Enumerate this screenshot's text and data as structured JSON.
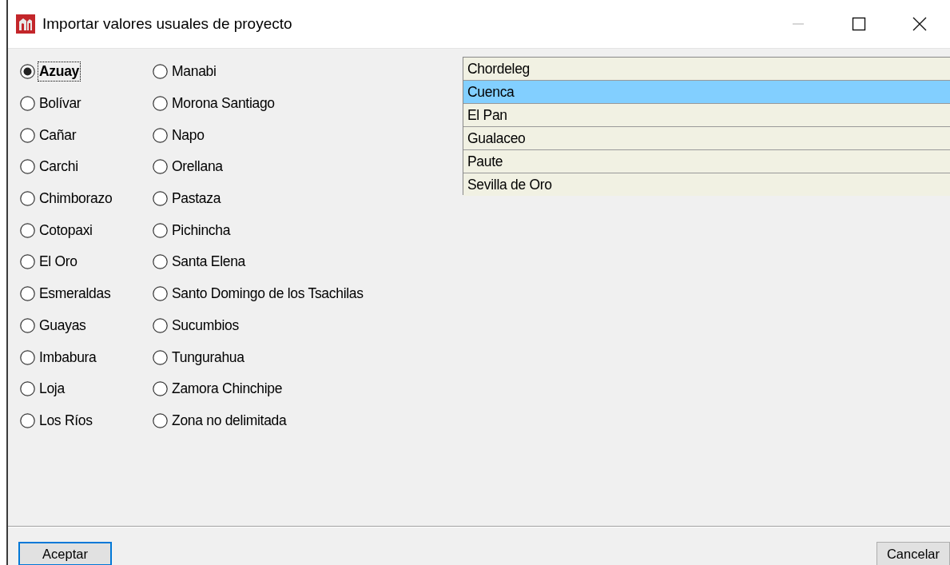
{
  "window": {
    "title": "Importar valores usuales de proyecto"
  },
  "provinces": [
    {
      "label": "Azuay",
      "selected": true
    },
    {
      "label": "Bolívar",
      "selected": false
    },
    {
      "label": "Cañar",
      "selected": false
    },
    {
      "label": "Carchi",
      "selected": false
    },
    {
      "label": "Chimborazo",
      "selected": false
    },
    {
      "label": "Cotopaxi",
      "selected": false
    },
    {
      "label": "El Oro",
      "selected": false
    },
    {
      "label": "Esmeraldas",
      "selected": false
    },
    {
      "label": "Guayas",
      "selected": false
    },
    {
      "label": "Imbabura",
      "selected": false
    },
    {
      "label": "Loja",
      "selected": false
    },
    {
      "label": "Los Ríos",
      "selected": false
    },
    {
      "label": "Manabi",
      "selected": false
    },
    {
      "label": "Morona Santiago",
      "selected": false
    },
    {
      "label": "Napo",
      "selected": false
    },
    {
      "label": "Orellana",
      "selected": false
    },
    {
      "label": "Pastaza",
      "selected": false
    },
    {
      "label": "Pichincha",
      "selected": false
    },
    {
      "label": "Santa Elena",
      "selected": false
    },
    {
      "label": "Santo Domingo de los Tsachilas",
      "selected": false
    },
    {
      "label": "Sucumbios",
      "selected": false
    },
    {
      "label": "Tungurahua",
      "selected": false
    },
    {
      "label": "Zamora Chinchipe",
      "selected": false
    },
    {
      "label": "Zona no delimitada",
      "selected": false
    }
  ],
  "cantons": [
    {
      "label": "Chordeleg",
      "selected": false
    },
    {
      "label": "Cuenca",
      "selected": true
    },
    {
      "label": "El Pan",
      "selected": false
    },
    {
      "label": "Gualaceo",
      "selected": false
    },
    {
      "label": "Paute",
      "selected": false
    },
    {
      "label": "Sevilla de Oro",
      "selected": false
    }
  ],
  "buttons": [
    "Aceptar",
    "Cancelar"
  ]
}
